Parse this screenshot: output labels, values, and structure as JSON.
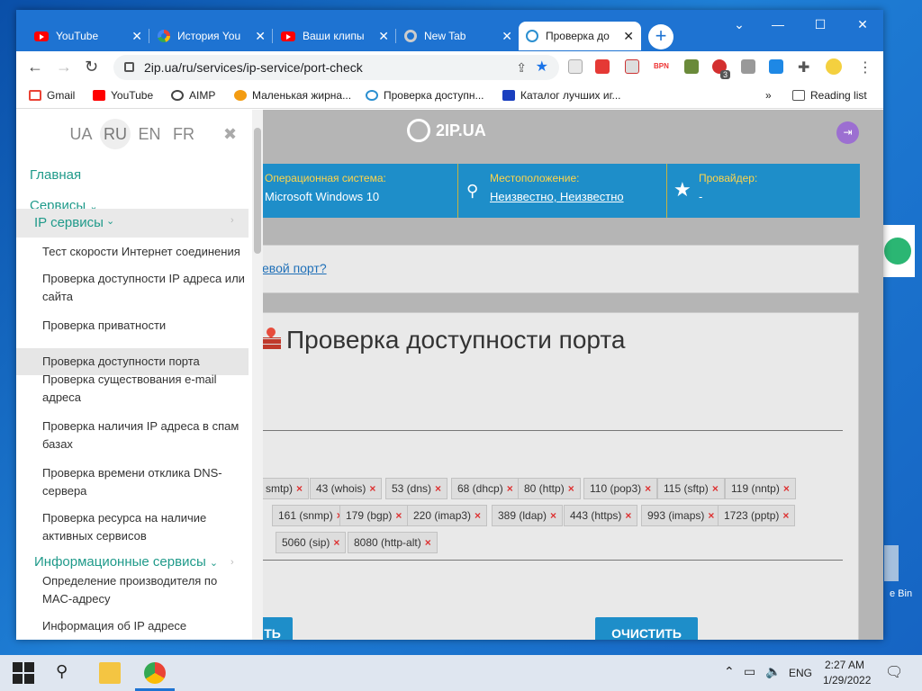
{
  "browser": {
    "tabs": [
      {
        "label": "YouTube",
        "icon": "youtube-icon"
      },
      {
        "label": "История You",
        "icon": "google-icon"
      },
      {
        "label": "Ваши клипы",
        "icon": "youtube-icon"
      },
      {
        "label": "New Tab",
        "icon": "chrome-icon"
      },
      {
        "label": "Проверка до",
        "icon": "2ip-icon",
        "active": true
      }
    ],
    "url": "2ip.ua/ru/services/ip-service/port-check",
    "bookmarks": [
      "Gmail",
      "YouTube",
      "AIMP",
      "Маленькая жирна...",
      "Проверка доступн...",
      "Каталог лучших иг..."
    ],
    "reading_list": "Reading list",
    "ext_badge": "3"
  },
  "sidebar": {
    "languages": [
      "UA",
      "RU",
      "EN",
      "FR"
    ],
    "selected_language": "RU",
    "main": "Главная",
    "services": "Сервисы",
    "ip_services": "IP сервисы",
    "ip_items": [
      "Тест скорости Интернет соединения",
      "Проверка доступности IP адреса или сайта",
      "Проверка приватности",
      "Проверка доступности порта",
      "Проверка существования e-mail адреса",
      "Проверка наличия IP адреса в спам базах",
      "Проверка времени отклика DNS-сервера",
      "Проверка ресурса на наличие активных сервисов"
    ],
    "info_services": "Информационные сервисы",
    "info_items": [
      "Определение производителя по MAC-адресу",
      "Информация об IP адресе"
    ]
  },
  "site": {
    "logo": "2IP.UA",
    "os_label": "Операционная система:",
    "os_value": "Microsoft Windows 10",
    "loc_label": "Местоположение:",
    "loc_value": "Неизвестно, Неизвестно",
    "isp_label": "Провайдер:",
    "isp_value": "-",
    "hint": "евой порт?",
    "title": "Проверка доступности порта",
    "ports_row1": [
      "smtp)",
      "43 (whois)",
      "53 (dns)",
      "68 (dhcp)",
      "80 (http)",
      "110 (pop3)",
      "115 (sftp)",
      "119 (nntp)"
    ],
    "ports_row2": [
      "161 (snmp)",
      "179 (bgp)",
      "220 (imap3)",
      "389 (ldap)",
      "443 (https)",
      "993 (imaps)",
      "1723 (pptp)"
    ],
    "ports_row3": [
      "5060 (sip)",
      "8080 (http-alt)"
    ],
    "btn_check": "ТЬ",
    "btn_clear": "ОЧИСТИТЬ"
  },
  "desktop": {
    "recycle_bin": "e Bin"
  },
  "taskbar": {
    "lang": "ENG",
    "time": "2:27 AM",
    "date": "1/29/2022"
  }
}
